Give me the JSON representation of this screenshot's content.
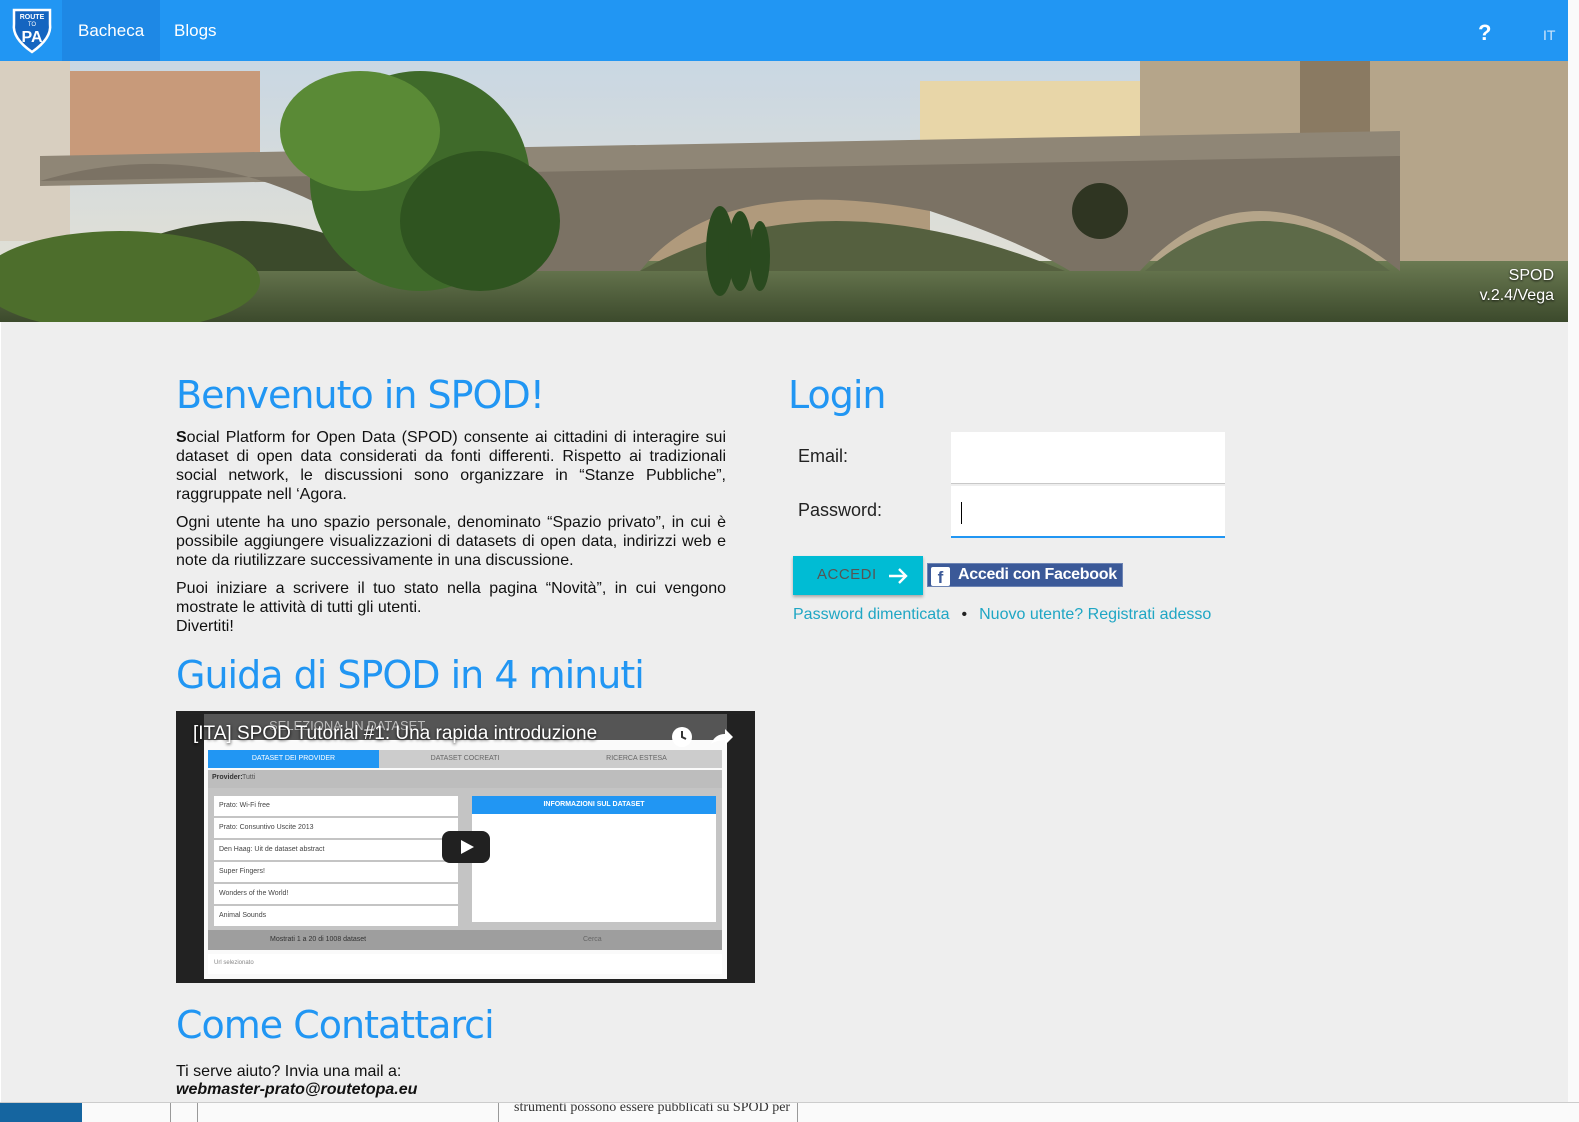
{
  "nav": {
    "logo_text_top": "ROUTE",
    "logo_text_mid": "TO",
    "logo_text_main": "PA",
    "items": [
      {
        "label": "Bacheca"
      },
      {
        "label": "Blogs"
      }
    ],
    "help": "?",
    "lang": "IT"
  },
  "hero": {
    "version_line1": "SPOD",
    "version_line2": "v.2.4/Vega"
  },
  "welcome": {
    "title": "Benvenuto in SPOD!",
    "p1_rest": "ocial Platform for Open Data (SPOD) consente ai cittadini di interagire sui dataset di open data considerati da fonti differenti. Rispetto ai tradizionali social network, le discussioni sono organizzare in “Stanze Pubbliche”, raggruppate nell ‘Agora.",
    "p2": "Ogni utente ha uno spazio personale, denominato “Spazio privato”, in cui è possibile aggiungere visualizzazioni di datasets di open data, indirizzi web e note da riutilizzare successivamente in una discussione.",
    "p3": "Puoi iniziare a scrivere il tuo stato nella pagina “Novità”, in cui vengono mostrate le attività di tutti gli utenti.",
    "p4": "Divertiti!"
  },
  "guide": {
    "title": "Guida di SPOD in 4 minuti",
    "video_title": "[ITA] SPOD Tutorial #1: Una rapida introduzione",
    "video_bg_heading": "SELEZIONA UN DATASET",
    "tabs": [
      "DATASET DEI PROVIDER",
      "DATASET COCREATI",
      "RICERCA ESTESA"
    ],
    "provider_label": "Provider:",
    "provider_value": "Tutti",
    "datasets": [
      "Prato: Wi-Fi free",
      "Prato: Consuntivo Uscite 2013",
      "Den Haag: Uit de dataset abstract",
      "Super Fingers!",
      "Wonders of the World!",
      "Animal Sounds"
    ],
    "info_header": "INFORMAZIONI SUL DATASET",
    "footer_count": "Mostrati 1 a 20 di 1008 dataset",
    "search_placeholder": "Cerca",
    "selected_label": "Url selezionato"
  },
  "contact": {
    "title": "Come Contattarci",
    "text": "Ti serve aiuto? Invia una mail a:",
    "email": "webmaster-prato@routetopa.eu"
  },
  "login": {
    "title": "Login",
    "email_label": "Email:",
    "email_value": "",
    "password_label": "Password:",
    "password_value": "",
    "submit_label": "ACCEDI",
    "facebook_label": "Accedi con Facebook",
    "forgot_link": "Password dimenticata",
    "separator": "•",
    "register_link": "Nuovo utente? Registrati adesso"
  },
  "bottom": {
    "text": "strumenti possono essere pubblicati su SPOD per"
  },
  "colors": {
    "primary": "#2196f3",
    "accent": "#00bcd4",
    "link": "#1fa6c4",
    "facebook": "#3b5998",
    "background": "#eeeeee"
  }
}
